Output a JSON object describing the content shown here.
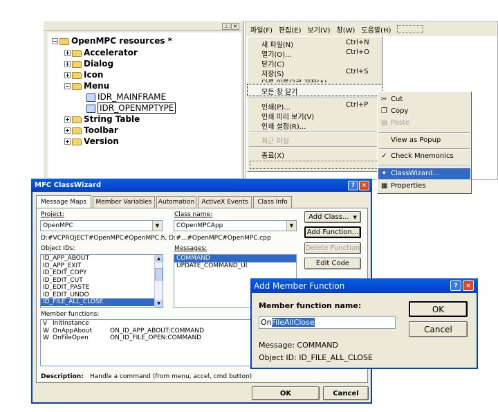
{
  "tree_panel": {
    "root": "OpenMPC resources *",
    "items": [
      "Accelerator",
      "Dialog",
      "Icon",
      "Menu",
      "String Table",
      "Toolbar",
      "Version"
    ],
    "menu_children": [
      "IDR_MAINFRAME",
      "IDR_OPENMPTYPE"
    ]
  },
  "menu_editor": {
    "menubar": [
      "파일(F)",
      "편집(E)",
      "보기(V)",
      "창(W)",
      "도움말(H)"
    ],
    "file_items": [
      {
        "label": "새 파일(N)",
        "shortcut": "Ctrl+N"
      },
      {
        "label": "열기(O)...",
        "shortcut": "Ctrl+O"
      },
      {
        "label": "닫기(C)",
        "shortcut": ""
      },
      {
        "label": "저장(S)",
        "shortcut": "Ctrl+S"
      },
      {
        "label": "다른 이름으로 저장(A)...",
        "shortcut": ""
      },
      {
        "label": "모든 창 닫기",
        "shortcut": ""
      },
      {
        "label": "인쇄(P)...",
        "shortcut": "Ctrl+P"
      },
      {
        "label": "인쇄 미리 보기(V)",
        "shortcut": ""
      },
      {
        "label": "인쇄 설정(R)...",
        "shortcut": ""
      },
      {
        "label": "최근 파일",
        "shortcut": ""
      },
      {
        "label": "종료(X)",
        "shortcut": ""
      }
    ]
  },
  "context_menu": {
    "items": [
      "Cut",
      "Copy",
      "Paste",
      "View as Popup",
      "Check Mnemonics",
      "ClassWizard...",
      "Properties"
    ]
  },
  "classwizard": {
    "title": "MFC ClassWizard",
    "tabs": [
      "Message Maps",
      "Member Variables",
      "Automation",
      "ActiveX Events",
      "Class Info"
    ],
    "project_label": "Project:",
    "project_value": "OpenMPC",
    "class_label": "Class name:",
    "class_value": "COpenMPCApp",
    "path": "D:#VCPROJECT#OpenMPC#OpenMPC.h, D:#...#OpenMPC#OpenMPC.cpp",
    "object_ids_label": "Object IDs:",
    "object_ids": [
      "ID_APP_ABOUT",
      "ID_APP_EXIT",
      "ID_EDIT_COPY",
      "ID_EDIT_CUT",
      "ID_EDIT_PASTE",
      "ID_EDIT_UNDO",
      "ID_FILE_ALL_CLOSE"
    ],
    "messages_label": "Messages:",
    "messages": [
      "COMMAND",
      "UPDATE_COMMAND_UI"
    ],
    "buttons": {
      "add_class": "Add Class...",
      "add_function": "Add Function...",
      "delete_function": "Delete Function",
      "edit_code": "Edit Code",
      "ok": "OK",
      "cancel": "Cancel"
    },
    "member_functions_label": "Member functions:",
    "member_functions": [
      {
        "flag": "V",
        "name": "InitInstance",
        "mapping": ""
      },
      {
        "flag": "W",
        "name": "OnAppAbout",
        "mapping": "ON_ID_APP_ABOUT:COMMAND"
      },
      {
        "flag": "W",
        "name": "OnFileOpen",
        "mapping": "ON_ID_FILE_OPEN:COMMAND"
      }
    ],
    "description_label": "Description:",
    "description": "Handle a command (from menu, accel, cmd button)"
  },
  "add_member": {
    "title": "Add Member Function",
    "name_label": "Member function name:",
    "name_prefix": "On",
    "name_selected": "FileAllClose",
    "ok": "OK",
    "cancel": "Cancel",
    "message": "Message: COMMAND",
    "object_id": "Object ID: ID_FILE_ALL_CLOSE"
  }
}
